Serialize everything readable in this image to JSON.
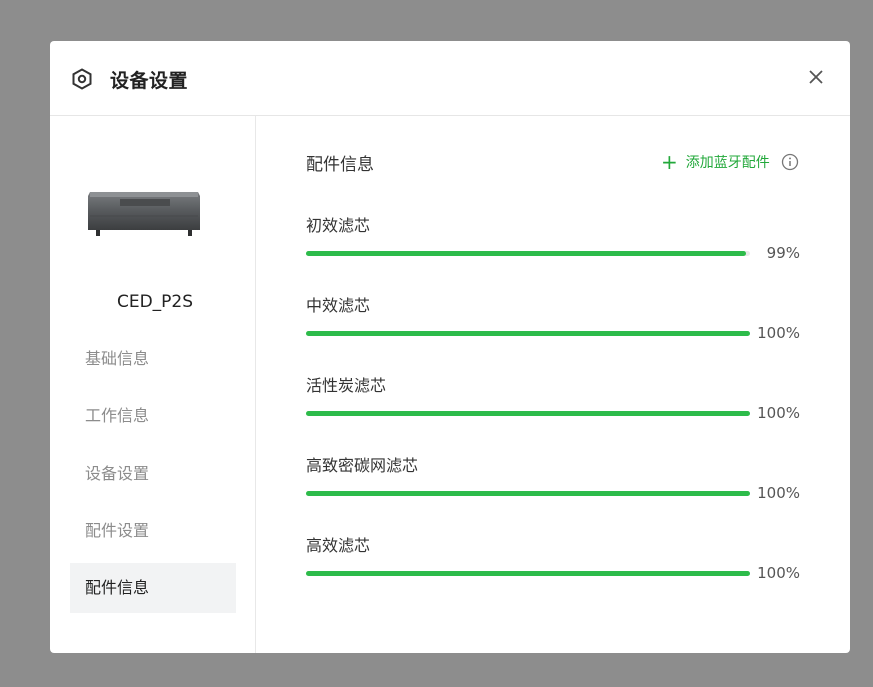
{
  "dialog": {
    "title": "设备设置",
    "icon": "hexagon-settings-icon",
    "close_icon": "close-icon"
  },
  "sidebar": {
    "device_name": "CED_P2S",
    "items": [
      {
        "label": "基础信息",
        "active": false
      },
      {
        "label": "工作信息",
        "active": false
      },
      {
        "label": "设备设置",
        "active": false
      },
      {
        "label": "配件设置",
        "active": false
      },
      {
        "label": "配件信息",
        "active": true
      }
    ]
  },
  "main": {
    "section_title": "配件信息",
    "add_accessory_label": "添加蓝牙配件",
    "add_icon": "plus-icon",
    "info_icon": "info-circle-icon",
    "filters": [
      {
        "name": "初效滤芯",
        "percent": 99,
        "percent_label": "99%"
      },
      {
        "name": "中效滤芯",
        "percent": 100,
        "percent_label": "100%"
      },
      {
        "name": "活性炭滤芯",
        "percent": 100,
        "percent_label": "100%"
      },
      {
        "name": "高致密碳网滤芯",
        "percent": 100,
        "percent_label": "100%"
      },
      {
        "name": "高效滤芯",
        "percent": 100,
        "percent_label": "100%"
      }
    ]
  },
  "colors": {
    "accent": "#2dbb4a",
    "accent_text": "#22a83a",
    "overlay": "#8d8d8d"
  }
}
